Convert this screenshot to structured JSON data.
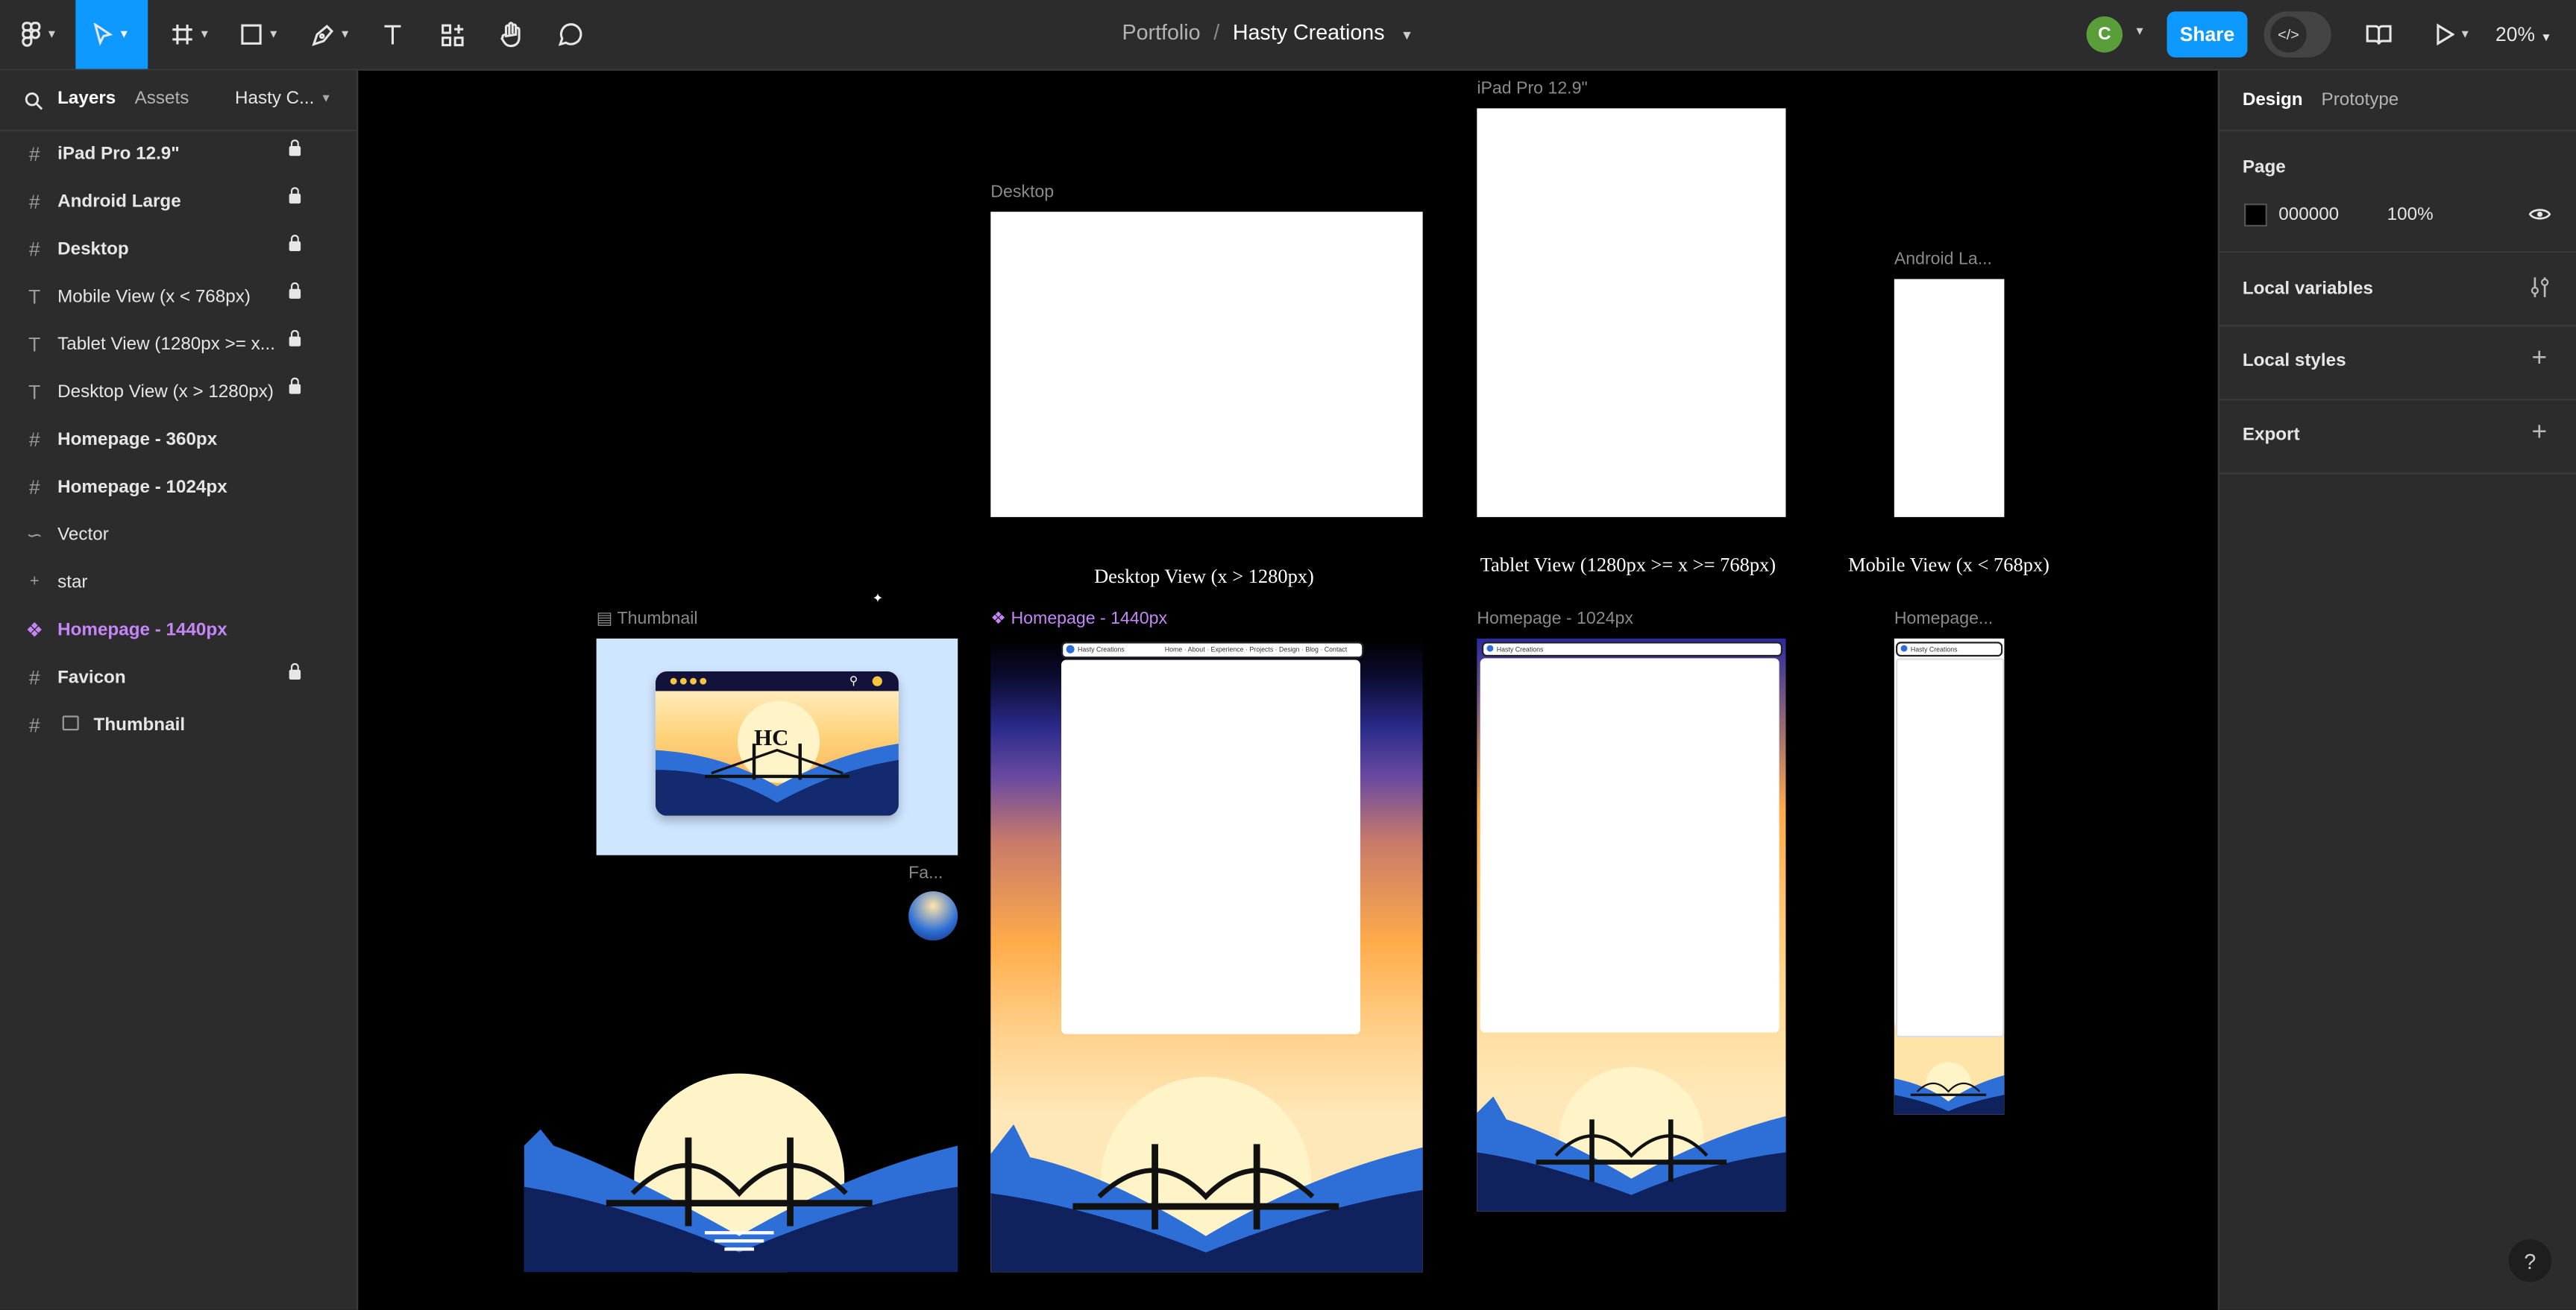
{
  "toolbar": {
    "breadcrumb_project": "Portfolio",
    "breadcrumb_sep": "/",
    "file_name": "Hasty Creations",
    "avatar_initial": "C",
    "share_label": "Share",
    "zoom": "20%"
  },
  "left_panel": {
    "tab_layers": "Layers",
    "tab_assets": "Assets",
    "page_name": "Hasty C...",
    "layers": [
      {
        "label": "iPad Pro 12.9\"",
        "icon": "frame-icon"
      },
      {
        "label": "Android Large",
        "icon": "frame-icon"
      },
      {
        "label": "Desktop",
        "icon": "frame-icon"
      },
      {
        "label": "Mobile View (x < 768px)",
        "icon": "text-icon"
      },
      {
        "label": "Tablet View (1280px >= x...",
        "icon": "text-icon"
      },
      {
        "label": "Desktop View (x > 1280px)",
        "icon": "text-icon"
      },
      {
        "label": "Homepage - 360px",
        "icon": "frame-icon"
      },
      {
        "label": "Homepage - 1024px",
        "icon": "frame-icon"
      },
      {
        "label": "Vector",
        "icon": "vector-icon"
      },
      {
        "label": "star",
        "icon": "star-icon"
      },
      {
        "label": "Homepage - 1440px",
        "icon": "component-icon"
      },
      {
        "label": "Favicon",
        "icon": "frame-icon"
      },
      {
        "label": "Thumbnail",
        "icon": "frame-icon"
      }
    ]
  },
  "right_panel": {
    "tab_design": "Design",
    "tab_prototype": "Prototype",
    "page_title": "Page",
    "page_color": "000000",
    "page_opacity": "100%",
    "local_variables": "Local variables",
    "local_styles": "Local styles",
    "export": "Export"
  },
  "canvas": {
    "desktop_label": "Desktop",
    "ipad_label": "iPad Pro 12.9\"",
    "android_label": "Android La...",
    "desktop_caption": "Desktop View (x > 1280px)",
    "tablet_caption": "Tablet View (1280px >= x >= 768px)",
    "mobile_caption": "Mobile View (x < 768px)",
    "thumbnail_label": "Thumbnail",
    "homepage1440_label": "Homepage - 1440px",
    "homepage1024_label": "Homepage - 1024px",
    "homepage360_label": "Homepage...",
    "favicon_label": "Fa...",
    "thumb_logo": "HC",
    "nav_brand": "Hasty Creations",
    "nav_links": "Home · About · Experience · Projects · Design · Blog · Contact"
  },
  "colors": {
    "accent": "#0d99ff",
    "component_purple": "#c586f7",
    "panel_bg": "#2c2c2c",
    "sky_dusk_top": "#1a1a6e",
    "sky_orange": "#ffab4a",
    "sky_cream": "#ffe4a8",
    "mountain_blue": "#2d6fd6"
  }
}
